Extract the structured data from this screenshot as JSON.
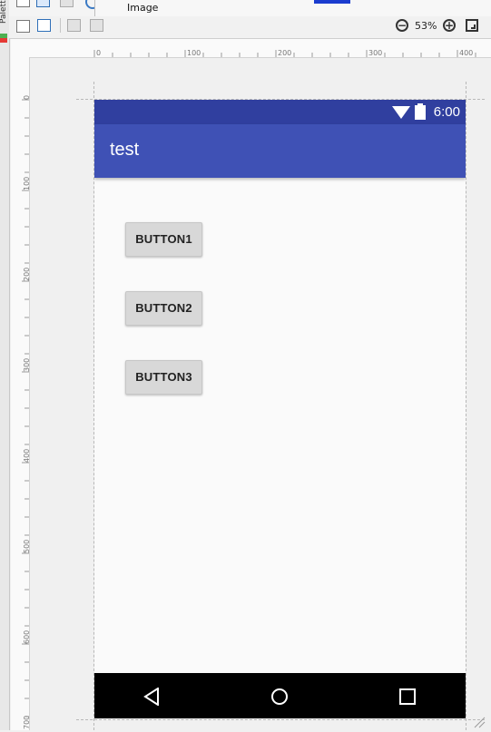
{
  "palette": {
    "label": "Palette"
  },
  "tooltip": {
    "text": "Image"
  },
  "zoom": {
    "value": "53%"
  },
  "rulers": {
    "x_ticks": [
      "0",
      "100",
      "200",
      "300",
      "400"
    ],
    "y_ticks": [
      "0",
      "100",
      "200",
      "300",
      "400",
      "500",
      "600",
      "700"
    ]
  },
  "device": {
    "status_bar": {
      "time": "6:00",
      "color": "#303f9f"
    },
    "app_bar": {
      "title": "test",
      "color": "#3f51b5"
    },
    "buttons": [
      {
        "label": "BUTTON1"
      },
      {
        "label": "BUTTON2"
      },
      {
        "label": "BUTTON3"
      }
    ],
    "nav_bar": {
      "icons": [
        "back-icon",
        "home-icon",
        "recents-icon"
      ]
    }
  }
}
